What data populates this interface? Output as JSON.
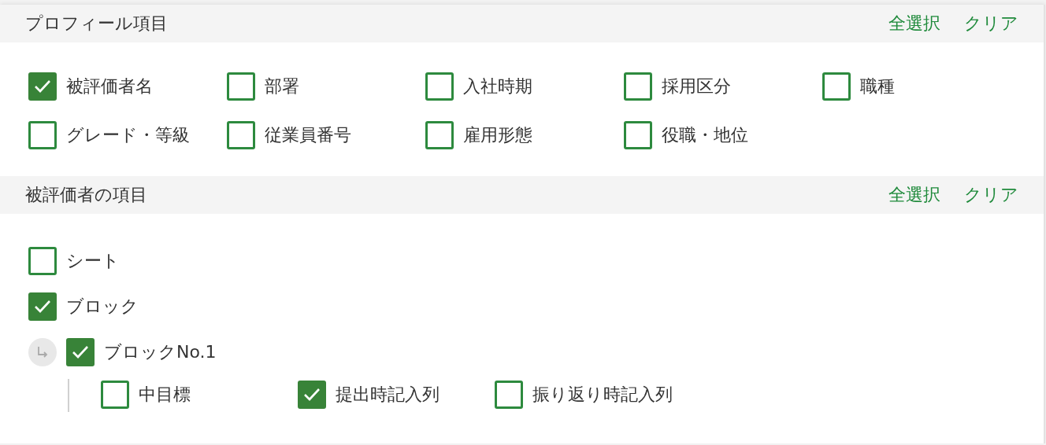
{
  "sections": [
    {
      "title": "プロフィール項目",
      "actions": [
        "全選択",
        "クリア"
      ],
      "options": [
        {
          "label": "被評価者名",
          "checked": true
        },
        {
          "label": "部署",
          "checked": false
        },
        {
          "label": "入社時期",
          "checked": false
        },
        {
          "label": "採用区分",
          "checked": false
        },
        {
          "label": "職種",
          "checked": false
        },
        {
          "label": "グレード・等級",
          "checked": false
        },
        {
          "label": "従業員番号",
          "checked": false
        },
        {
          "label": "雇用形態",
          "checked": false
        },
        {
          "label": "役職・地位",
          "checked": false
        }
      ]
    },
    {
      "title": "被評価者の項目",
      "actions": [
        "全選択",
        "クリア"
      ],
      "tree": [
        {
          "label": "シート",
          "checked": false
        },
        {
          "label": "ブロック",
          "checked": true,
          "children": [
            {
              "label": "ブロックNo.1",
              "checked": true,
              "children": [
                {
                  "label": "中目標",
                  "checked": false
                },
                {
                  "label": "提出時記入列",
                  "checked": true
                },
                {
                  "label": "振り返り時記入列",
                  "checked": false
                }
              ]
            }
          ]
        }
      ]
    }
  ]
}
